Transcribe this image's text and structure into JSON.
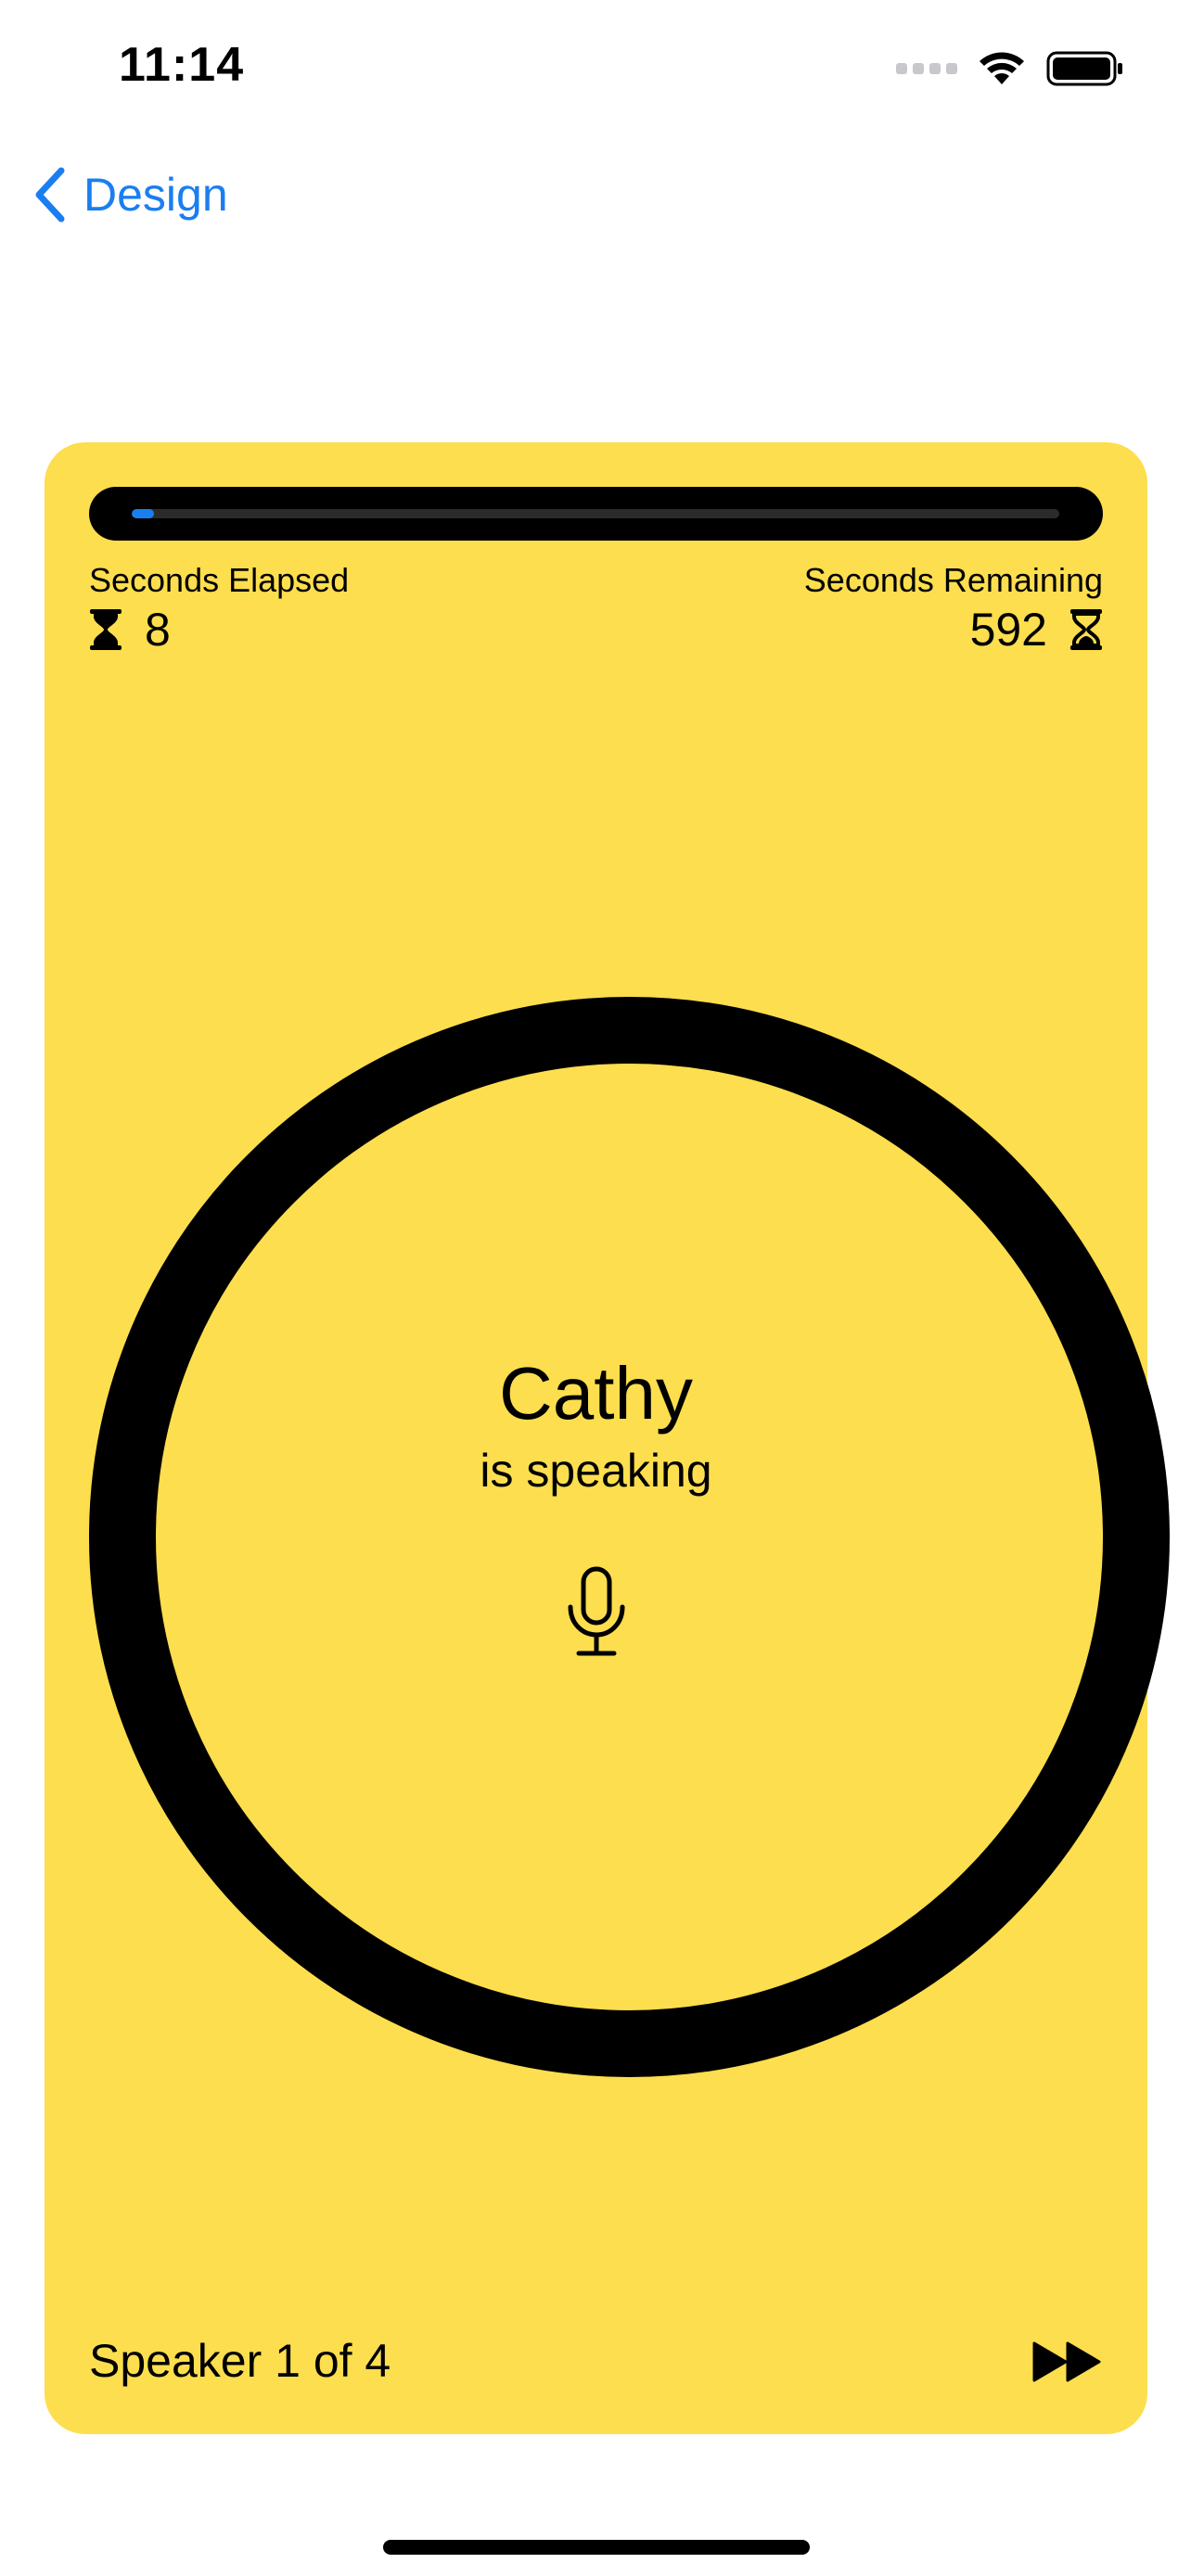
{
  "status_bar": {
    "time": "11:14"
  },
  "nav": {
    "back_label": "Design"
  },
  "timer": {
    "progress_fraction": 0.013,
    "elapsed_label": "Seconds Elapsed",
    "elapsed_value": "8",
    "remaining_label": "Seconds Remaining",
    "remaining_value": "592"
  },
  "speaker": {
    "name": "Cathy",
    "status": "is speaking",
    "footer": "Speaker 1 of 4"
  },
  "colors": {
    "card_background": "#fdde4e",
    "accent_blue": "#1a7ef0",
    "ring": "#000000"
  },
  "icons": {
    "back": "chevron-left-icon",
    "elapsed": "hourglass-icon",
    "remaining": "hourglass-icon",
    "mic": "mic-icon",
    "skip": "forward-icon"
  }
}
